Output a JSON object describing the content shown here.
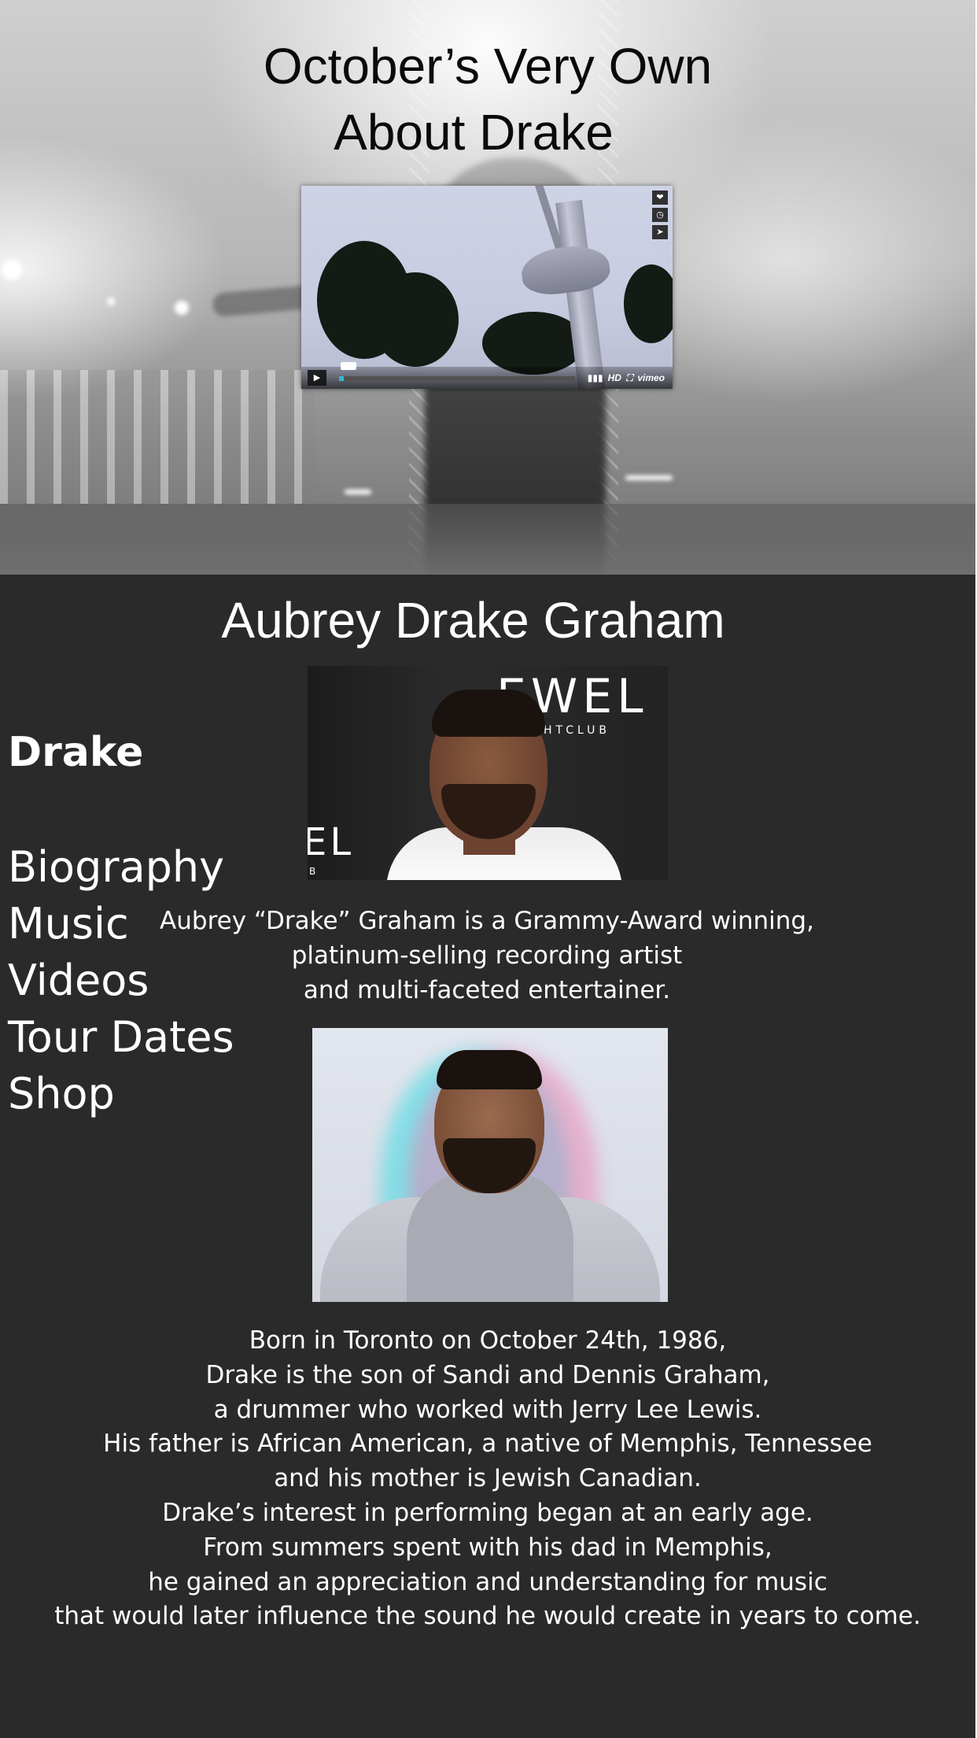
{
  "header": {
    "site_title": "October’s Very Own",
    "page_subtitle": "About Drake"
  },
  "video": {
    "progress_fraction": 0.02,
    "quality_label": "HD",
    "brand_label": "vimeo",
    "play_glyph": "▶",
    "like_glyph": "❤",
    "later_glyph": "◷",
    "share_glyph": "➤",
    "icons": [
      "play-icon",
      "heart-icon",
      "clock-icon",
      "share-icon",
      "volume-icon",
      "fullscreen-icon"
    ]
  },
  "artist": {
    "name": "Aubrey Drake Graham"
  },
  "sidebar": {
    "brand": "Drake",
    "items": [
      {
        "label": "Biography"
      },
      {
        "label": "Music"
      },
      {
        "label": "Videos"
      },
      {
        "label": "Tour Dates"
      },
      {
        "label": "Shop"
      }
    ]
  },
  "photo_1": {
    "backdrop_text": "EWEL",
    "backdrop_small": "HTCLUB",
    "backdrop_left": "EL",
    "backdrop_left_small": "B"
  },
  "intro": {
    "lines": [
      "Aubrey “Drake” Graham is a Grammy-Award winning,",
      "platinum-selling recording artist",
      "and multi-faceted entertainer."
    ]
  },
  "bio": {
    "lines": [
      "Born in Toronto on October 24th, 1986,",
      "Drake is the son of Sandi and Dennis Graham,",
      "a drummer who worked with Jerry Lee Lewis.",
      "His father is African American, a native of Memphis, Tennessee",
      "and his mother is Jewish Canadian.",
      "Drake’s interest in performing began at an early age.",
      "From summers spent with his dad in Memphis,",
      "he gained an appreciation and understanding for music",
      "that would later influence the sound he would create in years to come."
    ]
  },
  "colors": {
    "content_background": "#2a2a2b",
    "hero_title": "#0a0a0a",
    "body_text": "#ffffff",
    "player_accent": "#2fb8d6"
  }
}
